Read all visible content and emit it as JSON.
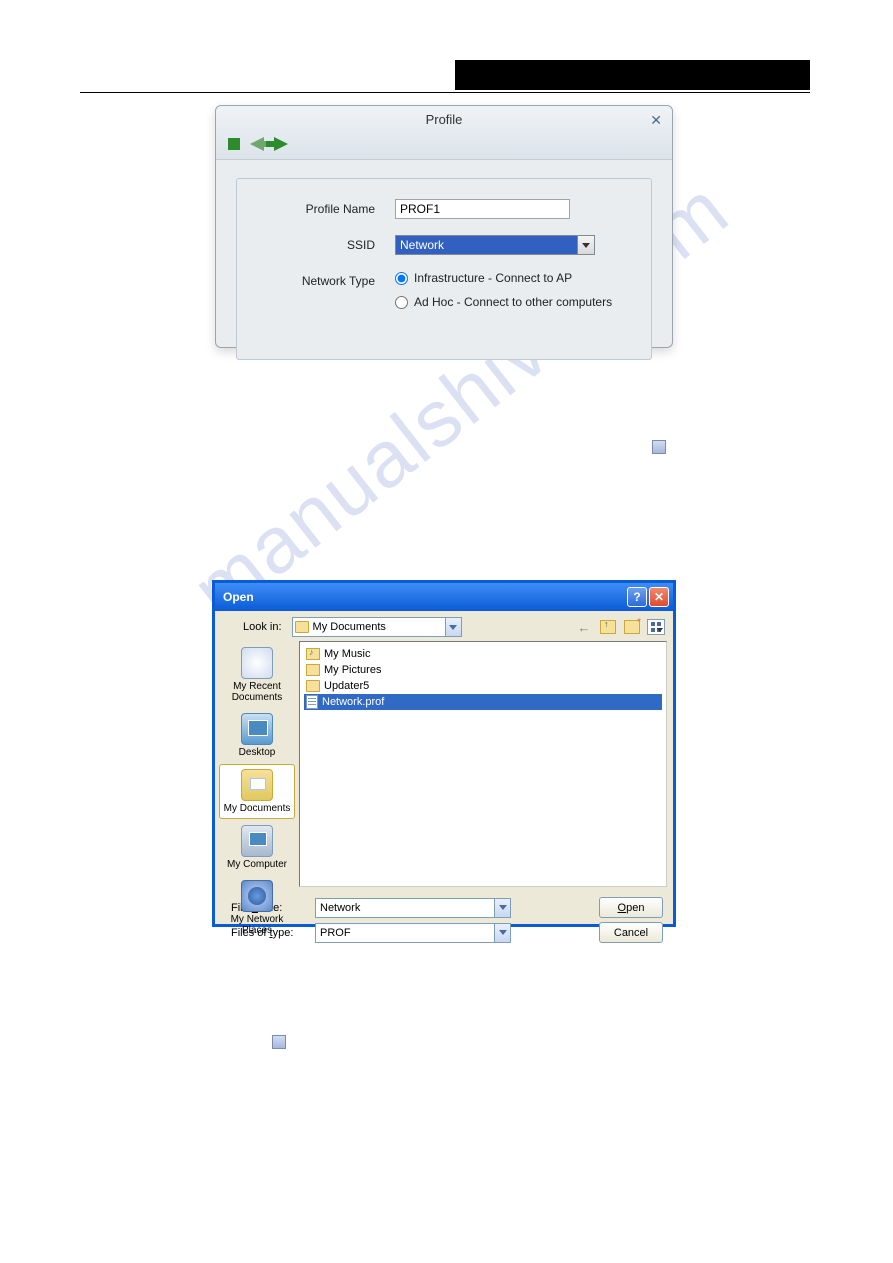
{
  "watermark": "manualshive.com",
  "profile_dialog": {
    "title": "Profile",
    "close_glyph": "✕",
    "fields": {
      "profile_name": {
        "label": "Profile Name",
        "value": "PROF1"
      },
      "ssid": {
        "label": "SSID",
        "value": "Network"
      },
      "network_type": {
        "label": "Network Type",
        "options": [
          {
            "label": "Infrastructure - Connect to AP",
            "selected": true
          },
          {
            "label": "Ad Hoc - Connect to other computers",
            "selected": false
          }
        ]
      }
    }
  },
  "open_dialog": {
    "title": "Open",
    "help_glyph": "?",
    "close_glyph": "✕",
    "lookin_label": "Look in:",
    "lookin_value": "My Documents",
    "places": [
      {
        "label": "My Recent Documents",
        "icon": "recent"
      },
      {
        "label": "Desktop",
        "icon": "desktop"
      },
      {
        "label": "My Documents",
        "icon": "mydocs",
        "selected": true
      },
      {
        "label": "My Computer",
        "icon": "computer"
      },
      {
        "label": "My Network Places",
        "icon": "netplaces"
      }
    ],
    "files": [
      {
        "name": "My Music",
        "type": "folder-music"
      },
      {
        "name": "My Pictures",
        "type": "folder-pics"
      },
      {
        "name": "Updater5",
        "type": "folder"
      },
      {
        "name": "Network.prof",
        "type": "file-prof",
        "selected": true
      }
    ],
    "filename_label": "File name:",
    "filename_value": "Network",
    "filetype_label": "Files of type:",
    "filetype_value": "PROF",
    "open_btn": "Open",
    "cancel_btn": "Cancel"
  }
}
